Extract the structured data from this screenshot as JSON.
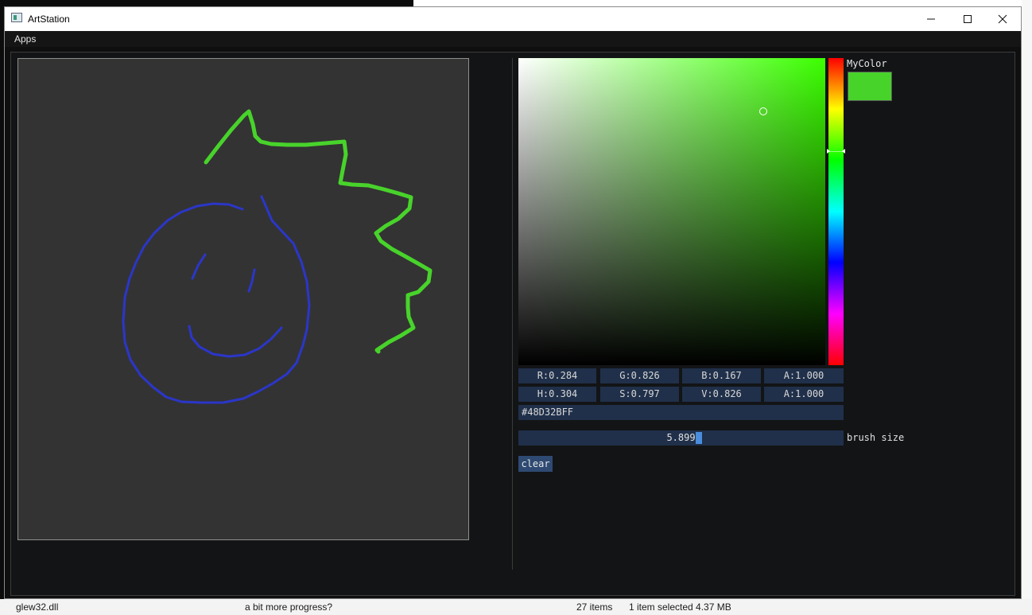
{
  "background": {
    "status_items": "27 items",
    "status_selected": "1 item selected  4.37 MB",
    "left_file": "glew32.dll",
    "commit_text": "a bit more progress?"
  },
  "window": {
    "title": "ArtStation",
    "minimize_icon": "minimize-icon",
    "maximize_icon": "maximize-icon",
    "close_icon": "close-icon"
  },
  "menu": {
    "items": [
      "Apps"
    ]
  },
  "color_picker": {
    "label": "MyColor",
    "hex": "#48D32BFF",
    "rgba": [
      "R:0.284",
      "G:0.826",
      "B:0.167",
      "A:1.000"
    ],
    "hsva": [
      "H:0.304",
      "S:0.797",
      "V:0.826",
      "A:1.000"
    ],
    "hue": 0.304,
    "saturation": 0.797,
    "value": 0.826,
    "color": "#48D32B"
  },
  "brush": {
    "value": "5.899",
    "label": "brush size",
    "fraction": 0.555
  },
  "buttons": {
    "clear": "clear"
  },
  "strokes": {
    "green": "#48D32B",
    "blue": "#2b36c9"
  }
}
